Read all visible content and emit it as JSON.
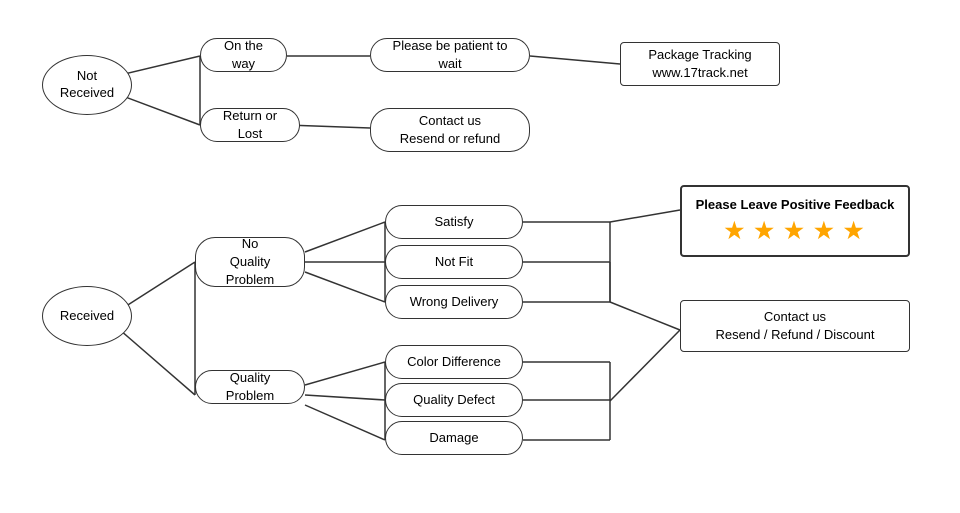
{
  "nodes": {
    "not_received": "Not\nReceived",
    "on_the_way": "On the way",
    "return_or_lost": "Return or Lost",
    "patient_wait": "Please be patient to wait",
    "package_tracking": "Package Tracking\nwww.17track.net",
    "contact_resend_refund": "Contact us\nResend or refund",
    "received": "Received",
    "no_quality_problem": "No\nQuality Problem",
    "quality_problem": "Quality Problem",
    "satisfy": "Satisfy",
    "not_fit": "Not Fit",
    "wrong_delivery": "Wrong Delivery",
    "color_difference": "Color Difference",
    "quality_defect": "Quality Defect",
    "damage": "Damage",
    "feedback_title": "Please Leave Positive Feedback",
    "feedback_stars": "★ ★ ★ ★ ★",
    "contact_resend_refund2": "Contact us\nResend / Refund / Discount"
  }
}
